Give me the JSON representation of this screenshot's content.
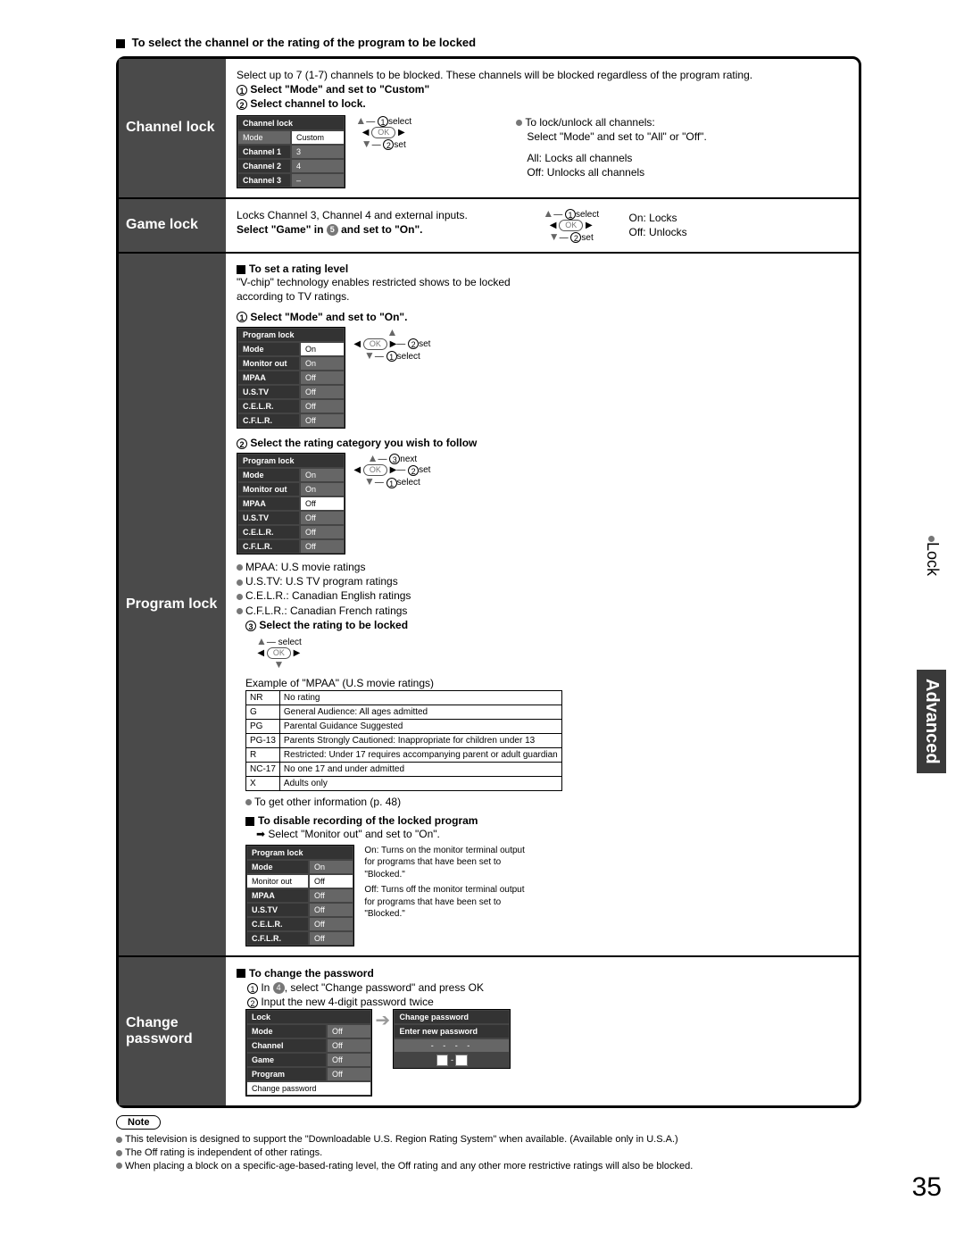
{
  "page_title": "To select the channel or the rating of the program to be locked",
  "page_number": "35",
  "side_label": "Lock",
  "side_advanced": "Advanced",
  "channel_lock": {
    "label": "Channel lock",
    "intro": "Select up to 7 (1-7) channels to be blocked. These channels will be blocked regardless of the program rating.",
    "step1": "Select \"Mode\" and set to \"Custom\"",
    "step2": "Select channel to lock.",
    "menu_title": "Channel lock",
    "menu": [
      [
        "Mode",
        "Custom"
      ],
      [
        "Channel 1",
        "3"
      ],
      [
        "Channel 2",
        "4"
      ],
      [
        "Channel 3",
        "–"
      ]
    ],
    "anno_select": "select",
    "anno_set": "set",
    "tip_head": "To lock/unlock all channels:",
    "tip_body": "Select \"Mode\" and set to \"All\" or \"Off\".",
    "tip_all": "All:  Locks all channels",
    "tip_off": "Off:  Unlocks all channels"
  },
  "game_lock": {
    "label": "Game lock",
    "desc": "Locks Channel 3, Channel 4 and external inputs.",
    "instr_pre": "Select \"Game\" in ",
    "instr_post": " and set to \"On\".",
    "instr_num": "5",
    "on_label": "On:  Locks",
    "off_label": "Off:  Unlocks",
    "anno_select": "select",
    "anno_set": "set"
  },
  "program_lock": {
    "label": "Program lock",
    "hdr1": "To set a rating level",
    "body1": "\"V-chip\" technology enables restricted shows to be locked according to TV ratings.",
    "step1": "Select \"Mode\" and set to \"On\".",
    "menu_title": "Program lock",
    "menu1": [
      [
        "Mode",
        "On"
      ],
      [
        "Monitor out",
        "On"
      ],
      [
        "MPAA",
        "Off"
      ],
      [
        "U.S.TV",
        "Off"
      ],
      [
        "C.E.L.R.",
        "Off"
      ],
      [
        "C.F.L.R.",
        "Off"
      ]
    ],
    "step2": "Select the rating category you wish to follow",
    "menu2": [
      [
        "Mode",
        "On"
      ],
      [
        "Monitor out",
        "On"
      ],
      [
        "MPAA",
        "Off"
      ],
      [
        "U.S.TV",
        "Off"
      ],
      [
        "C.E.L.R.",
        "Off"
      ],
      [
        "C.F.L.R.",
        "Off"
      ]
    ],
    "anno_next": "next",
    "anno_set": "set",
    "anno_select": "select",
    "legend": [
      "MPAA:      U.S movie ratings",
      "U.S.TV:    U.S TV program ratings",
      "C.E.L.R.:  Canadian English ratings",
      "C.F.L.R.:  Canadian French ratings"
    ],
    "step3": "Select the rating to be locked",
    "step3_anno": "select",
    "example_hdr": "Example of \"MPAA\" (U.S movie ratings)",
    "ratings": [
      [
        "NR",
        "No rating"
      ],
      [
        "G",
        "General Audience:  All ages admitted"
      ],
      [
        "PG",
        "Parental Guidance Suggested"
      ],
      [
        "PG-13",
        "Parents Strongly Cautioned: Inappropriate for children under 13"
      ],
      [
        "R",
        "Restricted: Under 17 requires accompanying parent or adult guardian"
      ],
      [
        "NC-17",
        "No one 17 and under admitted"
      ],
      [
        "X",
        "Adults only"
      ]
    ],
    "info_ref": "To get other information (p. 48)",
    "disable_hdr": "To disable recording of the locked program",
    "disable_instr": "Select \"Monitor out\" and set to \"On\".",
    "menu3": [
      [
        "Mode",
        "On"
      ],
      [
        "Monitor out",
        "Off"
      ],
      [
        "MPAA",
        "Off"
      ],
      [
        "U.S.TV",
        "Off"
      ],
      [
        "C.E.L.R.",
        "Off"
      ],
      [
        "C.F.L.R.",
        "Off"
      ]
    ],
    "on_desc": "On: Turns on the monitor terminal output for programs that have been set to \"Blocked.\"",
    "off_desc": "Off: Turns off the monitor terminal output for programs that have been set to \"Blocked.\""
  },
  "change_pw": {
    "label": "Change password",
    "hdr": "To change the password",
    "step1_pre": "In ",
    "step1_num": "4",
    "step1_post": ", select \"Change password\" and press OK",
    "step2": "Input the new 4-digit password twice",
    "lock_menu_title": "Lock",
    "lock_menu": [
      [
        "Mode",
        "Off"
      ],
      [
        "Channel",
        "Off"
      ],
      [
        "Game",
        "Off"
      ],
      [
        "Program",
        "Off"
      ],
      [
        "Change password",
        ""
      ]
    ],
    "cp_title": "Change password",
    "cp_prompt": "Enter new password",
    "cp_dots": "- - - -",
    "cp_keys": "0 - 9"
  },
  "note_label": "Note",
  "notes": [
    "This television is designed to support the  \"Downloadable U.S. Region Rating System\" when available.  (Available only in U.S.A.)",
    "The Off rating is independent of other ratings.",
    "When placing a block on a specific-age-based-rating level, the Off rating and any other more restrictive ratings will also be blocked."
  ]
}
